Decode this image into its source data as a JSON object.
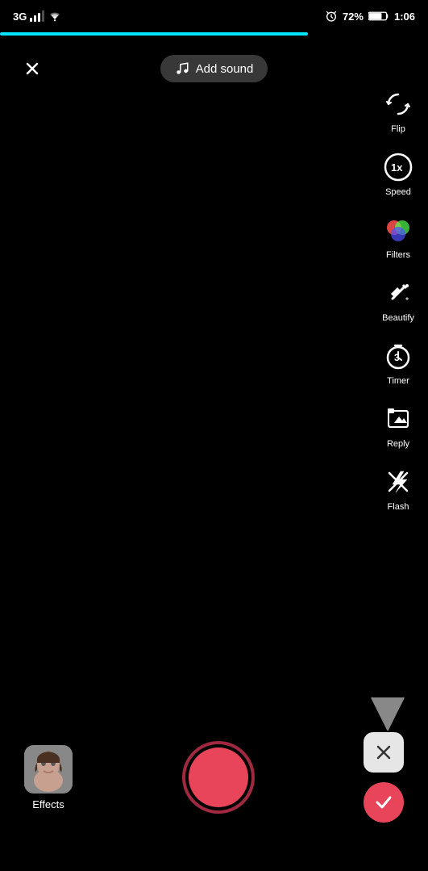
{
  "status": {
    "carrier": "3G",
    "signal": 3,
    "wifi": true,
    "battery_percent": "72%",
    "battery_icon": "battery",
    "time": "1:06",
    "alarm": true
  },
  "progress": {
    "width_percent": 72
  },
  "topbar": {
    "close_label": "✕",
    "add_sound_label": "Add sound"
  },
  "sidebar": {
    "items": [
      {
        "id": "flip",
        "label": "Flip",
        "icon": "flip"
      },
      {
        "id": "speed",
        "label": "Speed",
        "icon": "speed"
      },
      {
        "id": "filters",
        "label": "Filters",
        "icon": "filters"
      },
      {
        "id": "beautify",
        "label": "Beautify",
        "icon": "beautify"
      },
      {
        "id": "timer",
        "label": "Timer",
        "icon": "timer"
      },
      {
        "id": "reply",
        "label": "Reply",
        "icon": "reply"
      },
      {
        "id": "flash",
        "label": "Flash",
        "icon": "flash"
      }
    ]
  },
  "bottom": {
    "effects_label": "Effects",
    "delete_icon": "✕",
    "confirm_icon": "✓"
  }
}
